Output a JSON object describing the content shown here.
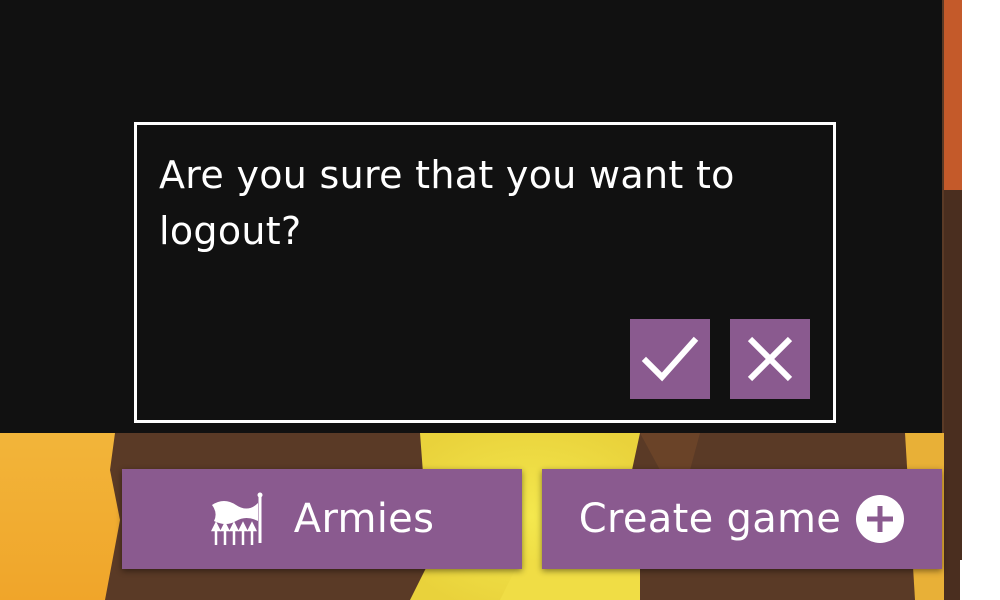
{
  "dialog": {
    "message": "Are you sure that you want to logout?",
    "confirm_icon": "check-icon",
    "cancel_icon": "close-icon"
  },
  "buttons": {
    "armies_label": "Armies",
    "armies_icon": "armies-banner-icon",
    "create_game_label": "Create game",
    "create_game_icon": "plus-circle-icon"
  },
  "colors": {
    "accent": "#8a5a8f",
    "overlay": "#111111",
    "text": "#ffffff"
  }
}
